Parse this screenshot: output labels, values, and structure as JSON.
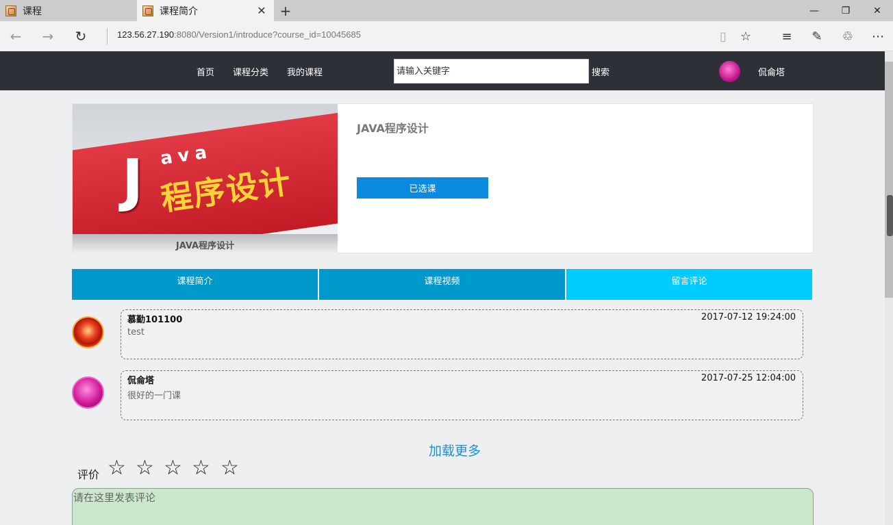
{
  "browser": {
    "tabs": [
      {
        "label": "课程"
      },
      {
        "label": "课程简介"
      }
    ],
    "url_host": "123.56.27.190",
    "url_rest": ":8080/Version1/introduce?course_id=10045685"
  },
  "header": {
    "nav": [
      "首页",
      "课程分类",
      "我的课程"
    ],
    "search_placeholder": "请输入关键字",
    "search_button": "搜索",
    "username": "侃侖塔"
  },
  "course": {
    "cover_letter": "J",
    "cover_ava": "ava",
    "cover_title": "程序设计",
    "cover_caption": "JAVA程序设计",
    "name": "JAVA程序设计",
    "enroll_label": "已选课"
  },
  "tabs": [
    {
      "label": "课程简介"
    },
    {
      "label": "课程视频"
    },
    {
      "label": "留言评论"
    }
  ],
  "comments": [
    {
      "user": "慕勤101100",
      "time": "2017-07-12 19:24:00",
      "text": "test"
    },
    {
      "user": "侃侖塔",
      "time": "2017-07-25 12:04:00",
      "text": "很好的一门课"
    }
  ],
  "load_more": "加载更多",
  "rating": {
    "label": "评价",
    "star_glyph": "☆",
    "stars_filled": 0,
    "stars_total": 5
  },
  "comment_input": {
    "placeholder": "请在这里发表评论"
  }
}
